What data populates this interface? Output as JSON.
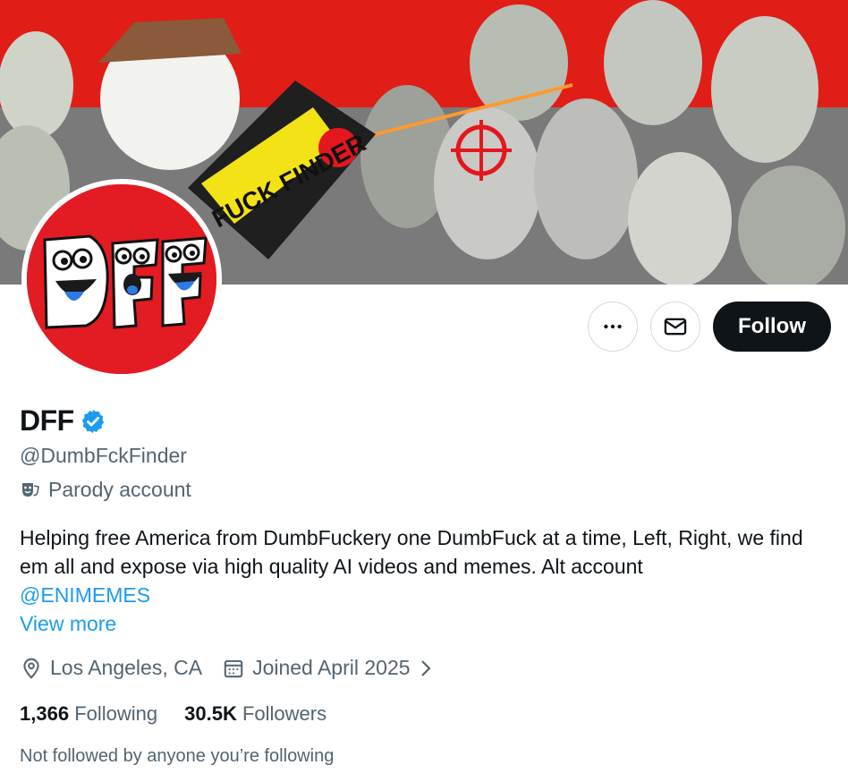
{
  "banner": {
    "text": "FUCK FINDER"
  },
  "avatar": {
    "text": "DFF"
  },
  "actions": {
    "more_label": "More",
    "message_label": "Message",
    "follow_label": "Follow"
  },
  "profile": {
    "display_name": "DFF",
    "verified": true,
    "handle": "@DumbFckFinder",
    "parody_label": "Parody account"
  },
  "bio": {
    "text": "Helping free America from DumbFuckery one DumbFuck at a time, Left, Right, we find em all and expose via high quality AI videos and memes. Alt account",
    "mention": "@ENIMEMES",
    "view_more": "View more"
  },
  "meta": {
    "location": "Los Angeles, CA",
    "joined": "Joined April 2025"
  },
  "stats": {
    "following_count": "1,366",
    "following_label": "Following",
    "followers_count": "30.5K",
    "followers_label": "Followers"
  },
  "social_context": "Not followed by anyone you’re following",
  "colors": {
    "accent": "#1d9bf0",
    "text": "#0f1419",
    "muted": "#536471",
    "brand_red": "#e31b23"
  }
}
